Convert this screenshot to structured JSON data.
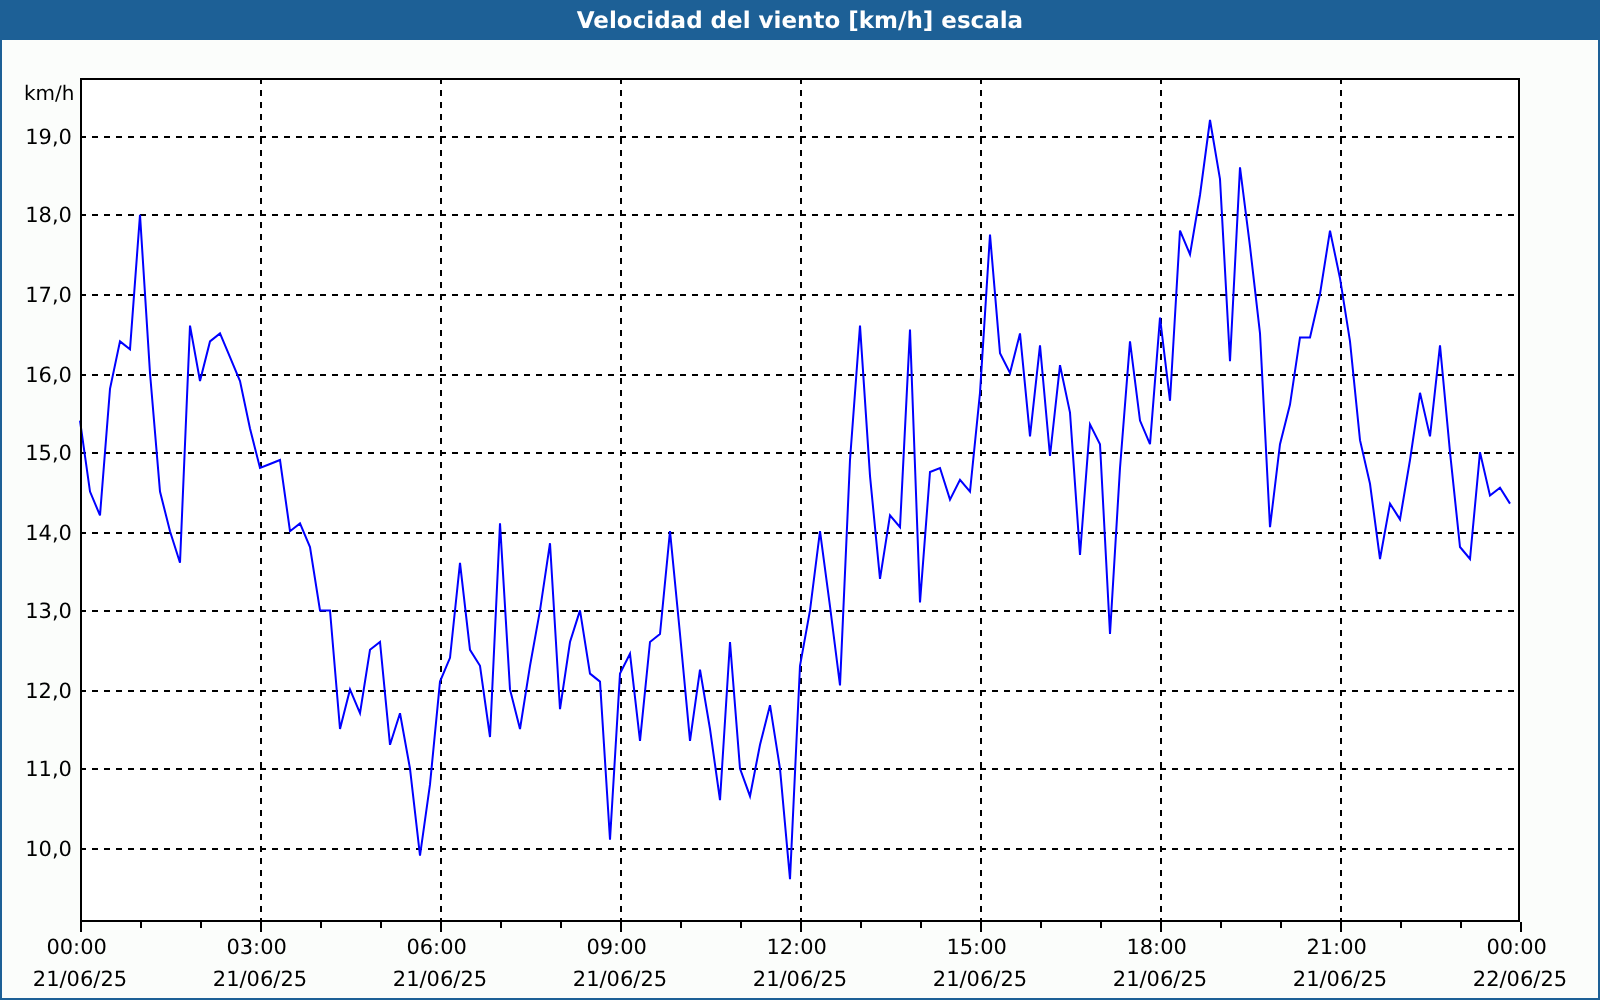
{
  "window": {
    "title": "Velocidad del viento [km/h] escala"
  },
  "chart": {
    "chart_data": {
      "type": "line",
      "ylabel": "km/h",
      "grid": true,
      "categories": [
        "00:00\n21/06/25",
        null,
        null,
        null,
        null,
        null,
        null,
        null,
        null,
        null,
        null,
        null,
        null,
        null,
        null,
        null,
        null,
        null,
        "03:00\n21/06/25",
        null,
        null,
        null,
        null,
        null,
        null,
        null,
        null,
        null,
        null,
        null,
        null,
        null,
        null,
        null,
        null,
        null,
        "06:00\n21/06/25",
        null,
        null,
        null,
        null,
        null,
        null,
        null,
        null,
        null,
        null,
        null,
        null,
        null,
        null,
        null,
        null,
        null,
        "09:00\n21/06/25",
        null,
        null,
        null,
        null,
        null,
        null,
        null,
        null,
        null,
        null,
        null,
        null,
        null,
        null,
        null,
        null,
        null,
        "12:00\n21/06/25",
        null,
        null,
        null,
        null,
        null,
        null,
        null,
        null,
        null,
        null,
        null,
        null,
        null,
        null,
        null,
        null,
        null,
        "15:00\n21/06/25",
        null,
        null,
        null,
        null,
        null,
        null,
        null,
        null,
        null,
        null,
        null,
        null,
        null,
        null,
        null,
        null,
        null,
        "18:00\n21/06/25",
        null,
        null,
        null,
        null,
        null,
        null,
        null,
        null,
        null,
        null,
        null,
        null,
        null,
        null,
        null,
        null,
        null,
        "21:00\n21/06/25",
        null,
        null,
        null,
        null,
        null,
        null,
        null,
        null,
        null,
        null,
        null,
        null,
        null,
        null,
        null,
        null,
        null,
        "00:00\n22/06/25"
      ],
      "series": [
        {
          "color": "#0000ff",
          "values": [
            15.4,
            14.5,
            14.2,
            15.8,
            16.4,
            16.3,
            18.0,
            16.0,
            14.5,
            14.0,
            13.6,
            16.6,
            15.9,
            16.4,
            16.5,
            16.2,
            15.9,
            15.3,
            14.8,
            14.85,
            14.9,
            14.0,
            14.1,
            13.8,
            13.0,
            13.0,
            11.5,
            12.0,
            11.7,
            12.5,
            12.6,
            11.3,
            11.7,
            11.0,
            9.9,
            10.8,
            12.1,
            12.4,
            13.6,
            12.5,
            12.3,
            11.4,
            14.1,
            12.0,
            11.5,
            12.3,
            13.0,
            13.85,
            11.75,
            12.6,
            13.0,
            12.2,
            12.1,
            10.1,
            12.2,
            12.45,
            11.35,
            12.6,
            12.7,
            14.0,
            12.7,
            11.35,
            12.25,
            11.5,
            10.6,
            12.6,
            11.0,
            10.65,
            11.3,
            11.8,
            11.0,
            9.6,
            12.3,
            13.0,
            14.0,
            13.05,
            12.05,
            14.9,
            16.6,
            14.7,
            13.4,
            14.2,
            14.05,
            16.55,
            13.1,
            14.75,
            14.8,
            14.4,
            14.65,
            14.5,
            15.75,
            17.75,
            16.25,
            16.0,
            16.5,
            15.2,
            16.35,
            14.95,
            16.1,
            15.5,
            13.7,
            15.35,
            15.1,
            12.7,
            14.8,
            16.4,
            15.4,
            15.1,
            16.7,
            15.65,
            17.8,
            17.5,
            18.25,
            19.2,
            18.45,
            16.15,
            18.6,
            17.6,
            16.5,
            14.05,
            15.1,
            15.6,
            16.45,
            16.45,
            17.0,
            17.8,
            17.2,
            16.4,
            15.15,
            14.6,
            13.65,
            14.35,
            14.15,
            14.9,
            15.75,
            15.2,
            16.35,
            15.0,
            13.8,
            13.65,
            15.0,
            14.45,
            14.55,
            14.35,
            null
          ]
        }
      ],
      "ylim": [
        9.06,
        19.73
      ],
      "yticks": [
        {
          "value": 10,
          "label": "10,0"
        },
        {
          "value": 11,
          "label": "11,0"
        },
        {
          "value": 12,
          "label": "12,0"
        },
        {
          "value": 13,
          "label": "13,0"
        },
        {
          "value": 14,
          "label": "14,0"
        },
        {
          "value": 15,
          "label": "15,0"
        },
        {
          "value": 16,
          "label": "16,0"
        },
        {
          "value": 17,
          "label": "17,0"
        },
        {
          "value": 18,
          "label": "18,0"
        },
        {
          "value": 19,
          "label": "19,0"
        }
      ]
    }
  }
}
